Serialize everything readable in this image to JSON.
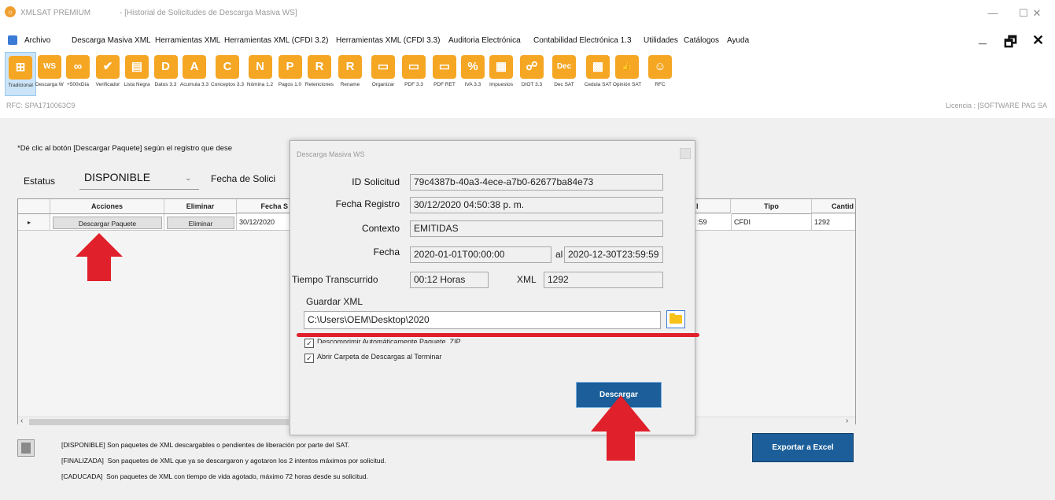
{
  "window": {
    "app_title": "XMLSAT PREMIUM",
    "doc_title": "- [Historial de Solicitudes de Descarga Masiva WS]",
    "minimize": "—",
    "maximize": "☐",
    "close": "✕"
  },
  "menu": {
    "items": [
      "Archivo",
      "Descarga Masiva XML",
      "Herramientas XML",
      "Herramientas XML (CFDI 3.2)",
      "Herramientas XML (CFDI 3.3)",
      "Auditoria Electrónica",
      "Contabilidad Electrónica 1.3",
      "Utilidades",
      "Catálogos",
      "Ayuda"
    ],
    "mdi_minimize": "_",
    "mdi_restore": "🗗",
    "mdi_close": "✕"
  },
  "toolbar": {
    "items": [
      {
        "label": "Tradicional",
        "icon": "grid-icon",
        "glyph": "⊞",
        "color": "#f5a623"
      },
      {
        "label": "Descarga WS",
        "icon": "ws-icon",
        "glyph": "WS",
        "color": "#f5a623"
      },
      {
        "label": "+500xDía",
        "icon": "link-icon",
        "glyph": "∞",
        "color": "#f5a623"
      },
      {
        "label": "Verificador",
        "icon": "check-icon",
        "glyph": "✔",
        "color": "#f5a623"
      },
      {
        "label": "Lista Negra",
        "icon": "folder-icon",
        "glyph": "▤",
        "color": "#f5a623"
      },
      {
        "label": "Datos 3.3",
        "icon": "letter-d-icon",
        "glyph": "D",
        "color": "#f5a623"
      },
      {
        "label": "Acumula 3.3",
        "icon": "letter-a-icon",
        "glyph": "A",
        "color": "#f5a623"
      },
      {
        "label": "Conceptos 3.3",
        "icon": "letter-c-icon",
        "glyph": "C",
        "color": "#f5a623"
      },
      {
        "label": "Nómina 1.2",
        "icon": "letter-n-icon",
        "glyph": "N",
        "color": "#f5a623"
      },
      {
        "label": "Pagos 1.0",
        "icon": "letter-p-icon",
        "glyph": "P",
        "color": "#f5a623"
      },
      {
        "label": "Retenciones",
        "icon": "letter-r-icon",
        "glyph": "R",
        "color": "#f5a623"
      },
      {
        "label": "Rename",
        "icon": "rename-icon",
        "glyph": "R",
        "color": "#f5a623"
      },
      {
        "label": "Organizar",
        "icon": "organize-icon",
        "glyph": "▭",
        "color": "#f5a623"
      },
      {
        "label": "PDF 3.3",
        "icon": "pdf-icon",
        "glyph": "▭",
        "color": "#f5a623"
      },
      {
        "label": "PDF RET",
        "icon": "pdf-ret-icon",
        "glyph": "▭",
        "color": "#f5a623"
      },
      {
        "label": "IVA 3.3",
        "icon": "percent-icon",
        "glyph": "%",
        "color": "#f5a623"
      },
      {
        "label": "Impuestos",
        "icon": "calculator-icon",
        "glyph": "▦",
        "color": "#f5a623"
      },
      {
        "label": "DIOT 3.3",
        "icon": "handshake-icon",
        "glyph": "☍",
        "color": "#f5a623"
      },
      {
        "label": "Dec SAT",
        "icon": "dec-icon",
        "glyph": "Dec",
        "color": "#f5a623"
      },
      {
        "label": "Cedula SAT",
        "icon": "qr-icon",
        "glyph": "▩",
        "color": "#f5a623"
      },
      {
        "label": "Opinión SAT",
        "icon": "thumbs-up-icon",
        "glyph": "👍",
        "color": "#f5a623"
      },
      {
        "label": "RFC",
        "icon": "person-icon",
        "glyph": "☺",
        "color": "#f5a623"
      }
    ]
  },
  "rfc_bar": {
    "rfc": "RFC: SPA1710063C9",
    "license": "Licencia : [SOFTWARE PAG SA"
  },
  "main": {
    "instruction": "*Dé clic al botón [Descargar Paquete] según el registro que dese",
    "status_label": "Estatus",
    "status_value": "DISPONIBLE",
    "fecha_label": "Fecha de Solici",
    "export_button": "Exportar a Excel"
  },
  "grid": {
    "headers": {
      "acciones": "Acciones",
      "eliminar": "Eliminar",
      "fecha": "Fecha S",
      "hora_fin": "l",
      "tipo": "Tipo",
      "cantidad": "Cantid"
    },
    "row": {
      "marker": "▸",
      "action_button": "Descargar Paquete",
      "delete_button": "Eliminar",
      "fecha": "30/12/2020",
      "hora_fin": ":59",
      "tipo": "CFDI",
      "cantidad": "1292"
    }
  },
  "dialog": {
    "title": "Descarga Masiva WS",
    "id_label": "ID Solicitud",
    "id_value": "79c4387b-40a3-4ece-a7b0-62677ba84e73",
    "fecha_reg_label": "Fecha Registro",
    "fecha_reg_value": "30/12/2020 04:50:38 p. m.",
    "contexto_label": "Contexto",
    "contexto_value": "EMITIDAS",
    "fecha_label": "Fecha",
    "fecha_from": "2020-01-01T00:00:00",
    "al_label": "al",
    "fecha_to": "2020-12-30T23:59:59",
    "tiempo_label": "Tiempo Transcurrido",
    "tiempo_value": "00:12 Horas",
    "xml_label": "XML",
    "xml_value": "1292",
    "guardar_label": "Guardar XML",
    "path_value": "C:\\Users\\OEM\\Desktop\\2020",
    "check1_label": "Descomprimir Automáticamente Paquete .ZIP",
    "check2_label": "Abrir Carpeta de Descargas al Terminar",
    "download_button": "Descargar"
  },
  "legend": {
    "line1": "[DISPONIBLE] Son paquetes de XML descargables o pendientes de liberación por parte del SAT.",
    "line2": "[FINALIZADA]  Son paquetes de XML que ya se descargaron y agotaron los 2 intentos máximos por solicitud.",
    "line3": "[CADUCADA]  Son paquetes de XML con tiempo de vida agotado, máximo 72 horas desde su solicitud."
  },
  "colors": {
    "accent_blue": "#1b5e99",
    "annotation_red": "#e0202a",
    "folder_yellow": "#f7c21a"
  }
}
